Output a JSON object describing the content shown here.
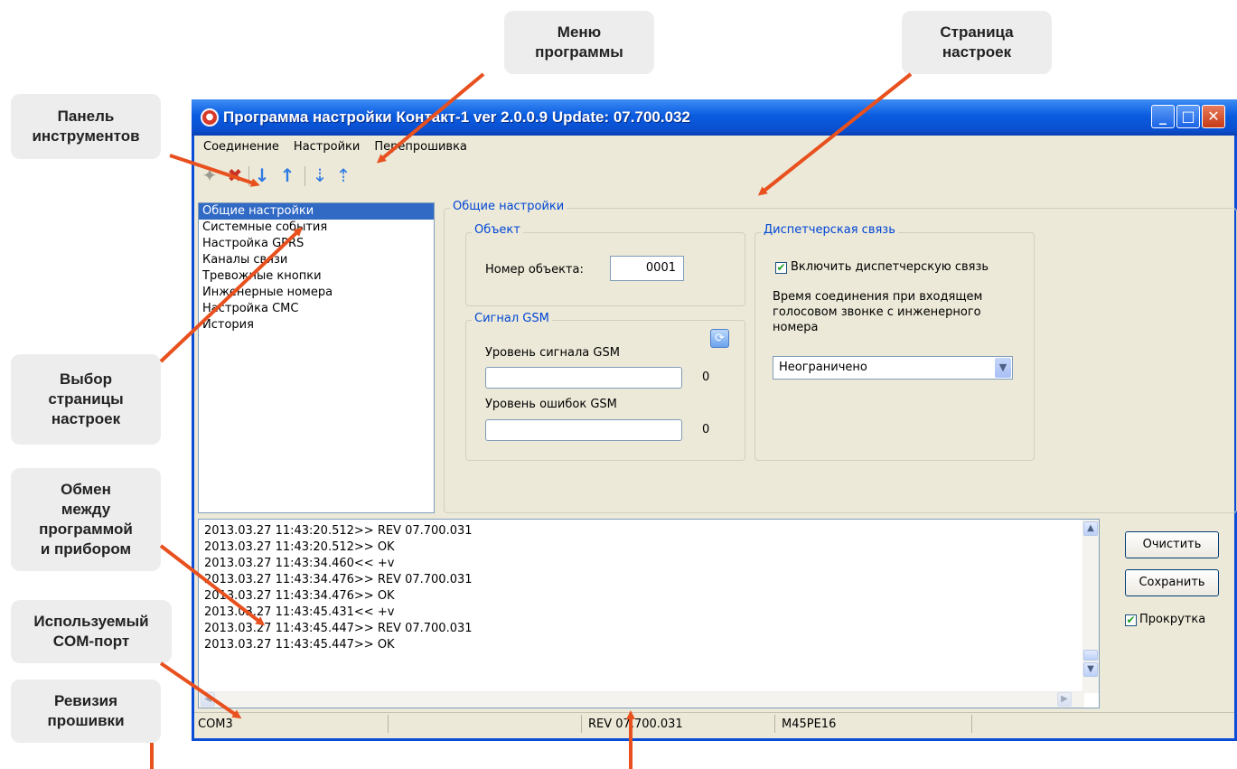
{
  "window": {
    "title": "Программа настройки Контакт-1 ver 2.0.0.9 Update: 07.700.032",
    "menu": [
      "Соединение",
      "Настройки",
      "Перепрошивка"
    ]
  },
  "nav": {
    "items": [
      "Общие настройки",
      "Системные события",
      "Настройка GPRS",
      "Каналы связи",
      "Тревожные кнопки",
      "Инженерные номера",
      "Настройка СМС",
      "История"
    ]
  },
  "settings": {
    "title": "Общие настройки",
    "object_group": "Объект",
    "object_number_label": "Номер объекта:",
    "object_number_value": "0001",
    "gsm_group": "Сигнал GSM",
    "gsm_signal_label": "Уровень сигнала GSM",
    "gsm_signal_value": "0",
    "gsm_error_label": "Уровень ошибок GSM",
    "gsm_error_value": "0",
    "dispatch_group": "Диспетчерская связь",
    "dispatch_enable_label": "Включить диспетчерскую связь",
    "dispatch_time_text": "Время соединения при входящем\nголосовом звонке с инженерного\nномера",
    "dispatch_time_value": "Неограничено"
  },
  "log": {
    "lines": [
      "2013.03.27 11:43:20.512>> REV 07.700.031",
      "2013.03.27 11:43:20.512>> OK",
      "2013.03.27 11:43:34.460<< +v",
      "2013.03.27 11:43:34.476>> REV 07.700.031",
      "2013.03.27 11:43:34.476>> OK",
      "2013.03.27 11:43:45.431<< +v",
      "2013.03.27 11:43:45.447>> REV 07.700.031",
      "2013.03.27 11:43:45.447>> OK"
    ],
    "clear_label": "Очистить",
    "save_label": "Сохранить",
    "scroll_label": "Прокрутка"
  },
  "status": {
    "port": "COM3",
    "revision": "REV 07.700.031",
    "chip": "M45PE16"
  },
  "callouts": {
    "menu": "Меню\nпрограммы",
    "settings_page": "Страница\nнастроек",
    "toolbar": "Панель\nинструментов",
    "page_select": "Выбор\nстраницы\nнастроек",
    "exchange": "Обмен\nмежду\nпрограммой\nи прибором",
    "com_port": "Используемый\nCOM-порт",
    "revision": "Ревизия\nпрошивки"
  },
  "colors": {
    "callout_bg": "#ededed",
    "arrow": "#e8501e",
    "title_bar": "#0a5ce0",
    "group_label": "#0046d5",
    "selection": "#316ac5"
  }
}
